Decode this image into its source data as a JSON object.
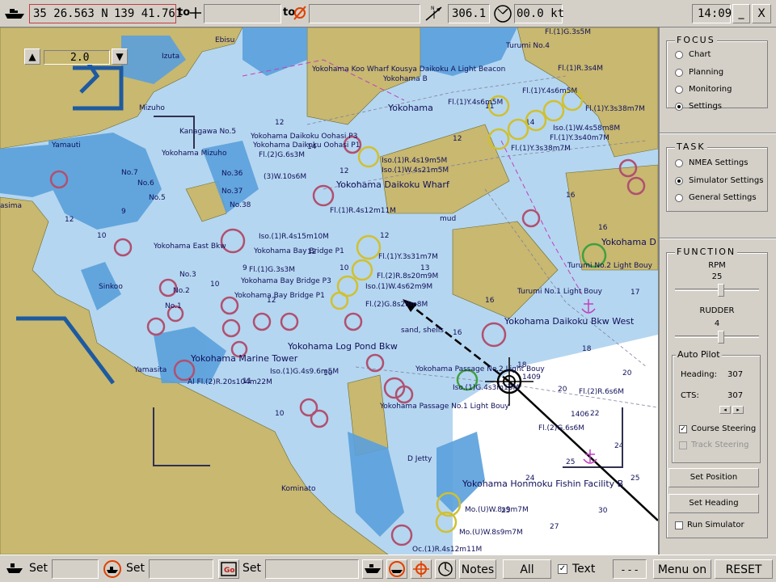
{
  "topbar": {
    "position": {
      "lat": "35 26.563 N",
      "lon": "139 41.761"
    },
    "to1_label": "to",
    "to2_label": "to",
    "course": "306.1",
    "speed": "00.0 kt",
    "time": "14:09",
    "minimize": "_",
    "close": "X"
  },
  "zoom": {
    "value": "2.0",
    "up": "▲",
    "down": "▼"
  },
  "focus": {
    "title": "FOCUS",
    "options": [
      "Chart",
      "Planning",
      "Monitoring",
      "Settings"
    ],
    "selected": 3
  },
  "task": {
    "title": "TASK",
    "options": [
      "NMEA Settings",
      "Simulator Settings",
      "General Settings"
    ],
    "selected": 1
  },
  "function": {
    "title": "FUNCTION",
    "rpm_label": "RPM",
    "rpm_value": "25",
    "rpm_level": 0.55,
    "rudder_label": "RUDDER",
    "rudder_value": "4",
    "rudder_level": 0.55,
    "autopilot": {
      "title": "Auto Pilot",
      "heading_label": "Heading:",
      "heading_value": "307",
      "cts_label": "CTS:",
      "cts_value": "307",
      "course_steering": "Course Steering",
      "track_steering": "Track Steering"
    },
    "set_position": "Set Position",
    "set_heading": "Set Heading",
    "run_simulator": "Run Simulator"
  },
  "bottombar": {
    "set1": "Set",
    "set2": "Set",
    "set3": "Set",
    "notes": "Notes",
    "all": "All",
    "text": "Text",
    "dashes": "- - -",
    "menu_on": "Menu on",
    "reset": "RESET"
  },
  "map": {
    "labels": [
      "Yokohama Koo Wharf Kousya Daikoku A Light Beacon",
      "Yokohama B",
      "Fl.(1)Y.4s6m5M",
      "Yokohama",
      "Yokohama Daikoku Oohasi P3",
      "Yokohama Daikoku Oohasi P1",
      "Fl.(2)G.6s3M",
      "(3)W.10s6M",
      "Iso.(1)R.4s19m5M",
      "Iso.(1)W.4s21m5M",
      "Yokohama Daikoku Wharf",
      "Fl.(1)R.4s12m11M",
      "Kanagawa No.5",
      "Yokohama Mizuho",
      "Yokohama East Bkw",
      "Iso.(1)R.4s15m10M",
      "Yokohama Bay Bridge P1",
      "Fl.(1)Y.3s31m7M",
      "Fl.(2)R.8s20m9M",
      "Iso.(1)W.4s62m9M",
      "Yokohama Bay Bridge P3",
      "Yokohama Bay Bridge P1",
      "Fl.(1)G.3s3M",
      "Fl.(2)G.8s28m8M",
      "Yokohama Log Pond Bkw",
      "Yokohama Marine Tower",
      "Iso.(1)G.4s9.6m5M",
      "Al Fl.(2)R.20s104m22M",
      "Yokohama Passage No.2 Light Bouy",
      "Iso.(1)G.4s3m13M",
      "Yokohama Passage No.1 Light Bouy",
      "Fl.(2)R.6s6M",
      "Fl.(2)G.6s6M",
      "Yokohama Daikoku Bkw West",
      "Turumi No.1 Light Bouy",
      "Turumi No.2 Light Bouy",
      "Yokohama D",
      "Yokohama Honmoku Fishin Facility B",
      "Mo.(U)W.8s9m7M",
      "Mo.(U)W.8s9m7M",
      "Oc.(1)R.4s12m11M",
      "D Jetty",
      "Kominato",
      "Yamasita",
      "Sinkoo",
      "Yamauti",
      "Izuta",
      "Ebisu",
      "Mizuho",
      "Turumi No.4",
      "Fl.(1)G.3s5M",
      "Fl.(1)R.3s4M",
      "Fl.(1)Y.3s38m7M",
      "Fl.(1)Y.3s40m7M",
      "Iso.(1)W.4s58m8M",
      "Fl.(1)Y.3s38m7M",
      "Fl.(1)Y.4s6m5M",
      "1409",
      "1406",
      "No.7",
      "No.6",
      "No.5",
      "No.36",
      "No.37",
      "No.38",
      "No.3",
      "No.2",
      "No.1",
      "asima",
      "mud",
      "sand, shells"
    ]
  }
}
